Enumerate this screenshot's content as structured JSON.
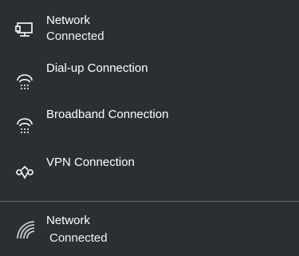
{
  "connections": [
    {
      "title": "Network",
      "status": "Connected",
      "icon": "wired-network-icon"
    },
    {
      "title": "Dial-up Connection",
      "icon": "dialup-icon"
    },
    {
      "title": "Broadband Connection",
      "icon": "broadband-icon"
    },
    {
      "title": "VPN Connection",
      "icon": "vpn-icon"
    }
  ],
  "bottom": {
    "title": "Network",
    "status": "Connected",
    "icon": "wifi-icon"
  },
  "colors": {
    "background": "#2b2f33",
    "text": "#ffffff",
    "divider": "#6b6f73"
  }
}
